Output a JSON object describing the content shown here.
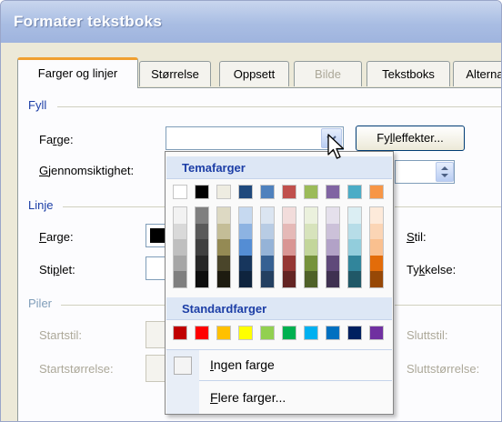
{
  "window": {
    "title": "Formater tekstboks"
  },
  "tabs": [
    {
      "label": "Farger og linjer",
      "state": "active"
    },
    {
      "label": "Størrelse",
      "state": "normal"
    },
    {
      "label": "Oppsett",
      "state": "normal"
    },
    {
      "label": "Bilde",
      "state": "disabled"
    },
    {
      "label": "Tekstboks",
      "state": "normal"
    },
    {
      "label": "Alterna",
      "state": "normal"
    }
  ],
  "fill": {
    "heading": "Fyll",
    "color_label": "Farge:",
    "transparency_label": "Gjennomsiktighet:",
    "fill_effects_button": "Fylleffekter..."
  },
  "line": {
    "heading": "Linje",
    "color_label": "Farge:",
    "dashed_label": "Stiplet:",
    "style_label": "Stil:",
    "weight_label": "Tykkelse:"
  },
  "arrows": {
    "heading": "Piler",
    "start_style_label": "Startstil:",
    "start_size_label": "Startstørrelse:",
    "end_style_label": "Sluttstil:",
    "end_size_label": "Sluttstørrelse:"
  },
  "palette": {
    "theme_heading": "Temafarger",
    "standard_heading": "Standardfarger",
    "no_color": "Ingen farge",
    "more_colors": "Flere farger...",
    "theme_colors": [
      {
        "base": "#ffffff",
        "shades": [
          "#f2f2f2",
          "#d9d9d9",
          "#bfbfbf",
          "#a6a6a6",
          "#7f7f7f"
        ]
      },
      {
        "base": "#000000",
        "shades": [
          "#7f7f7f",
          "#595959",
          "#404040",
          "#262626",
          "#0d0d0d"
        ]
      },
      {
        "base": "#eeece1",
        "shades": [
          "#ddd9c3",
          "#c4bd97",
          "#948a54",
          "#4a452a",
          "#1d1b10"
        ]
      },
      {
        "base": "#1f497d",
        "shades": [
          "#c6d9f0",
          "#8db3e2",
          "#548dd4",
          "#17365d",
          "#0f243e"
        ]
      },
      {
        "base": "#4f81bd",
        "shades": [
          "#dbe5f1",
          "#b8cce4",
          "#95b3d7",
          "#366092",
          "#244061"
        ]
      },
      {
        "base": "#c0504d",
        "shades": [
          "#f2dcdb",
          "#e5b9b7",
          "#d99694",
          "#953734",
          "#632423"
        ]
      },
      {
        "base": "#9bbb59",
        "shades": [
          "#ebf1dd",
          "#d7e3bc",
          "#c3d69b",
          "#76923c",
          "#4f6128"
        ]
      },
      {
        "base": "#8064a2",
        "shades": [
          "#e5e0ec",
          "#ccc1d9",
          "#b2a2c7",
          "#5f497a",
          "#3f3151"
        ]
      },
      {
        "base": "#4bacc6",
        "shades": [
          "#dbeef3",
          "#b7dde8",
          "#92cddc",
          "#31859b",
          "#205867"
        ]
      },
      {
        "base": "#f79646",
        "shades": [
          "#fdeada",
          "#fbd5b5",
          "#fac08f",
          "#e36c09",
          "#974806"
        ]
      }
    ],
    "standard_colors": [
      "#c00000",
      "#ff0000",
      "#ffc000",
      "#ffff00",
      "#92d050",
      "#00b050",
      "#00b0f0",
      "#0070c0",
      "#002060",
      "#7030a0"
    ]
  }
}
